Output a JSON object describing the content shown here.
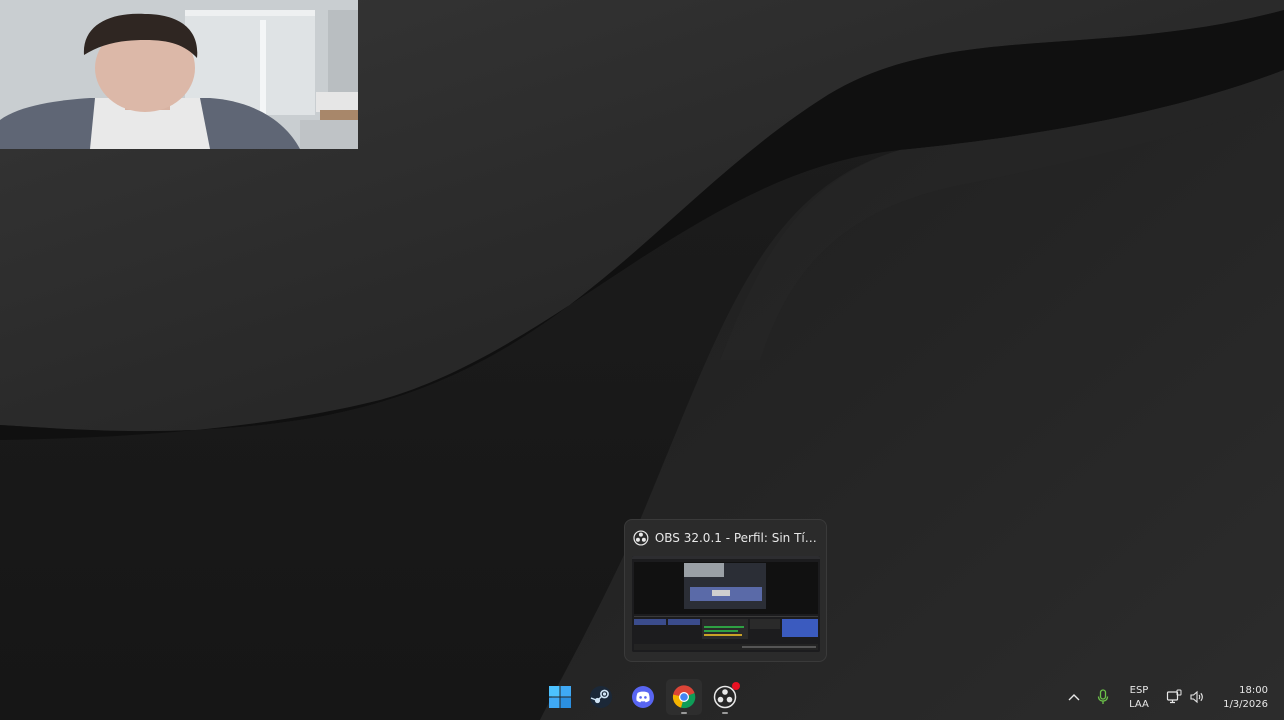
{
  "preview": {
    "window_title": "OBS 32.0.1 - Perfil: Sin Títul..."
  },
  "taskbar": {
    "apps": [
      {
        "name": "start-menu",
        "icon": "windows-logo-icon"
      },
      {
        "name": "steam",
        "icon": "steam-icon"
      },
      {
        "name": "discord",
        "icon": "discord-icon"
      },
      {
        "name": "chrome",
        "icon": "chrome-icon"
      },
      {
        "name": "obs",
        "icon": "obs-icon"
      }
    ],
    "tray": {
      "language_line1": "ESP",
      "language_line2": "LAA",
      "time": "18:00",
      "date": "1/3/2026"
    }
  },
  "colors": {
    "wallpaper_dark": "#141414",
    "wallpaper_light": "#2f2f2f",
    "accent_windows": "#3fa9f5",
    "discord": "#5865f2",
    "obs_notification": "#e81123"
  }
}
